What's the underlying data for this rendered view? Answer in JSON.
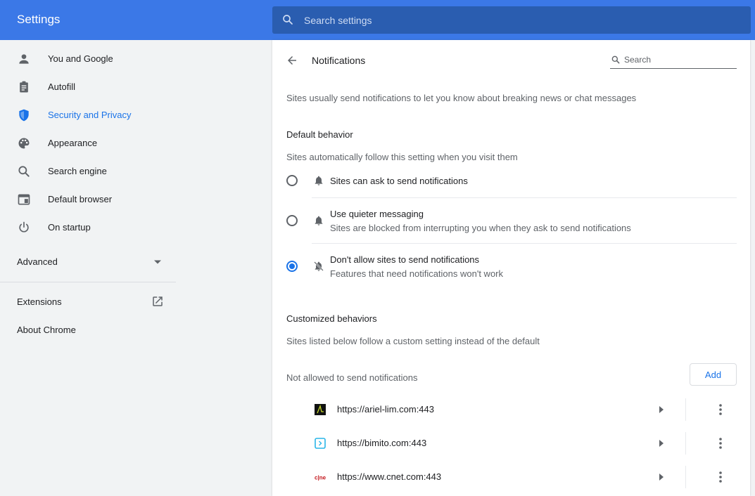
{
  "header": {
    "title": "Settings",
    "search_placeholder": "Search settings"
  },
  "sidebar": {
    "items": [
      {
        "label": "You and Google",
        "icon": "person-icon"
      },
      {
        "label": "Autofill",
        "icon": "clipboard-icon"
      },
      {
        "label": "Security and Privacy",
        "icon": "shield-icon",
        "active": true
      },
      {
        "label": "Appearance",
        "icon": "palette-icon"
      },
      {
        "label": "Search engine",
        "icon": "search-icon"
      },
      {
        "label": "Default browser",
        "icon": "browser-window-icon"
      },
      {
        "label": "On startup",
        "icon": "power-icon"
      }
    ],
    "advanced_label": "Advanced",
    "extensions_label": "Extensions",
    "about_label": "About Chrome"
  },
  "main": {
    "title": "Notifications",
    "search_placeholder": "Search",
    "intro": "Sites usually send notifications to let you know about breaking news or chat messages",
    "default_heading": "Default behavior",
    "default_sub": "Sites automatically follow this setting when you visit them",
    "options": [
      {
        "title": "Sites can ask to send notifications",
        "sub": "",
        "checked": false,
        "icon": "bell-icon"
      },
      {
        "title": "Use quieter messaging",
        "sub": "Sites are blocked from interrupting you when they ask to send notifications",
        "checked": false,
        "icon": "bell-icon"
      },
      {
        "title": "Don't allow sites to send notifications",
        "sub": "Features that need notifications won't work",
        "checked": true,
        "icon": "bell-off-icon"
      }
    ],
    "custom_heading": "Customized behaviors",
    "custom_sub": "Sites listed below follow a custom setting instead of the default",
    "blocked_label": "Not allowed to send notifications",
    "add_label": "Add",
    "sites": [
      {
        "url": "https://ariel-lim.com:443",
        "favicon": "ariel-lim-favicon"
      },
      {
        "url": "https://bimito.com:443",
        "favicon": "bimito-favicon"
      },
      {
        "url": "https://www.cnet.com:443",
        "favicon": "cnet-favicon",
        "favicon_text": "c|net"
      }
    ]
  },
  "colors": {
    "accent": "#1a73e8",
    "header_bg": "#3b78e7",
    "search_bg": "#2a5db0"
  }
}
